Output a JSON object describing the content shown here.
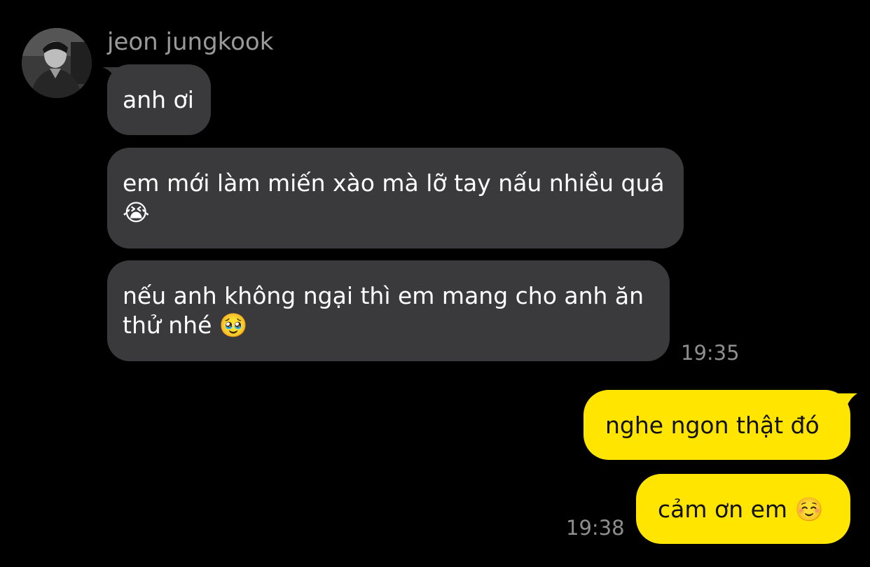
{
  "contact": {
    "name": "jeon jungkook"
  },
  "incoming": [
    {
      "text": "anh ơi"
    },
    {
      "text": "em mới làm miến xào mà lỡ tay nấu nhiều quá\n😭"
    },
    {
      "text": "nếu anh không ngại thì em mang cho anh ăn\nthử nhé 🥹"
    }
  ],
  "incoming_time": "19:35",
  "outgoing": [
    {
      "text": "nghe ngon thật đó"
    },
    {
      "text": "cảm ơn em ☺️"
    }
  ],
  "outgoing_time": "19:38",
  "colors": {
    "background": "#000000",
    "incoming_bubble": "#3a3a3c",
    "outgoing_bubble": "#ffe500",
    "timestamp": "#8e8e8e",
    "name": "#9a9a9a"
  }
}
